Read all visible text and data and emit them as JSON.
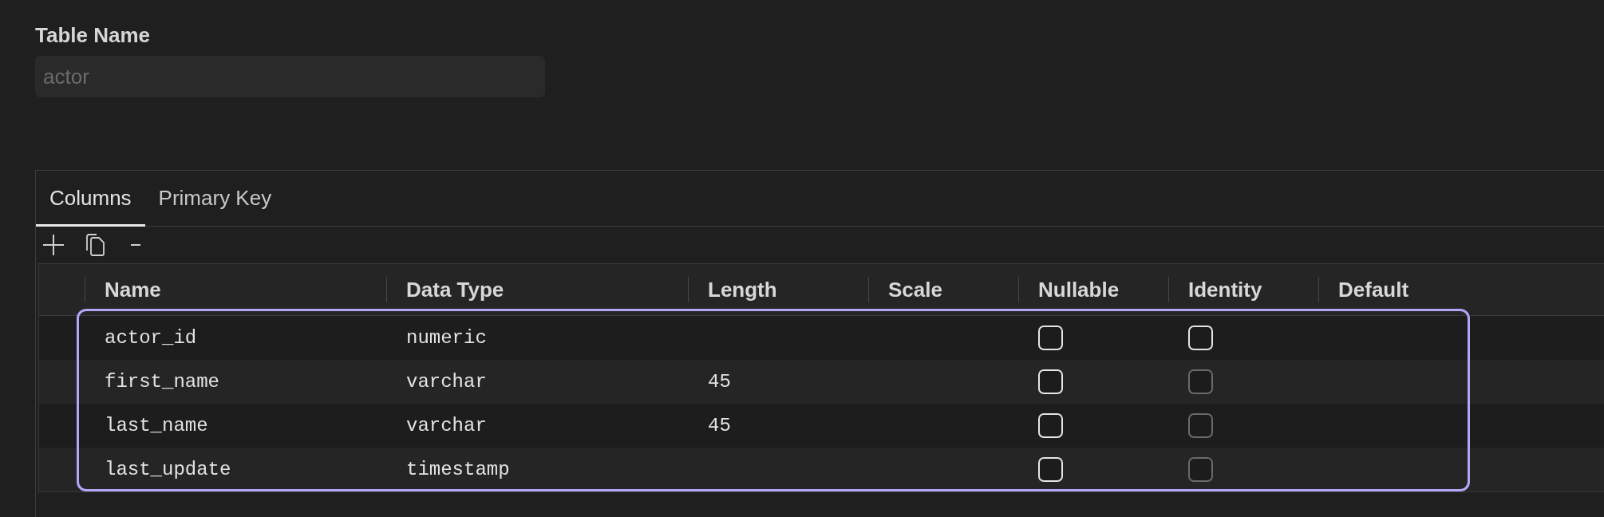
{
  "table_name": {
    "label": "Table Name",
    "value": "actor",
    "disabled": true
  },
  "tabs": [
    {
      "label": "Columns",
      "selected": true
    },
    {
      "label": "Primary Key",
      "selected": false
    }
  ],
  "grid": {
    "focused": true,
    "columns": [
      "Name",
      "Data Type",
      "Length",
      "Scale",
      "Nullable",
      "Identity",
      "Default"
    ],
    "rows": [
      {
        "name": "actor_id",
        "data_type": "numeric",
        "nullable": {
          "checked": false,
          "disabled": false
        },
        "identity": {
          "checked": false,
          "disabled": false
        }
      },
      {
        "name": "first_name",
        "data_type": "varchar",
        "length": "45",
        "nullable": {
          "checked": false,
          "disabled": false
        },
        "identity": {
          "checked": false,
          "disabled": true
        }
      },
      {
        "name": "last_name",
        "data_type": "varchar",
        "length": "45",
        "nullable": {
          "checked": false,
          "disabled": false
        },
        "identity": {
          "checked": false,
          "disabled": true
        }
      },
      {
        "name": "last_update",
        "data_type": "timestamp",
        "nullable": {
          "checked": false,
          "disabled": false
        },
        "identity": {
          "checked": false,
          "disabled": true
        }
      }
    ]
  }
}
